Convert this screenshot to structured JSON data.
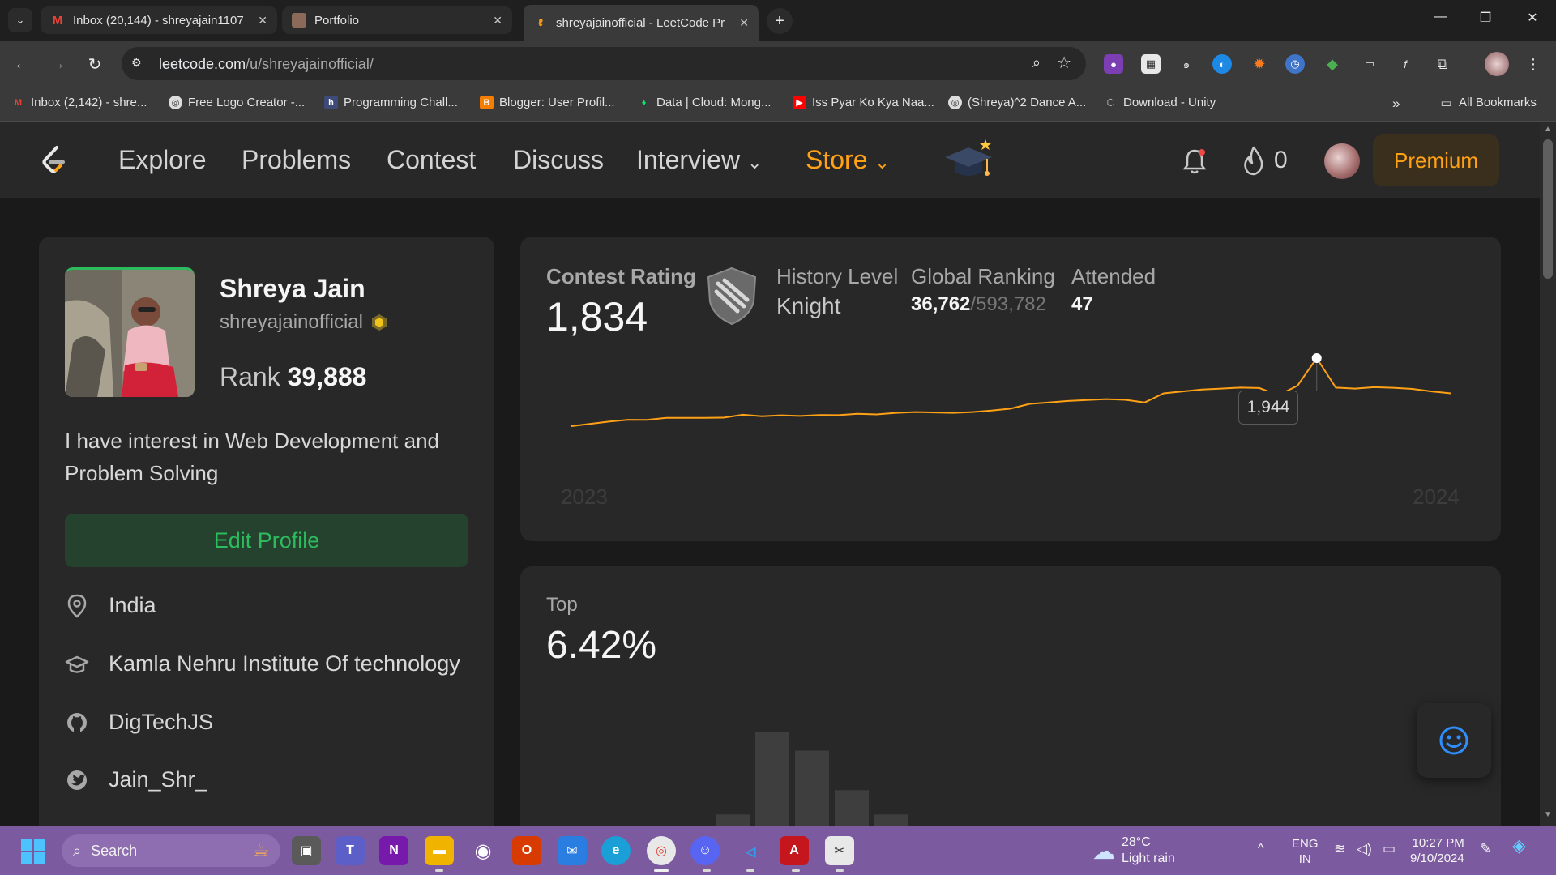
{
  "browser": {
    "tabs": [
      {
        "title": "Inbox (20,144) - shreyajain1107",
        "favicon": "gmail-icon"
      },
      {
        "title": "Portfolio",
        "favicon": "portfolio-avatar-icon"
      },
      {
        "title": "shreyajainofficial - LeetCode Pr",
        "favicon": "leetcode-icon",
        "active": true
      }
    ],
    "url_host": "leetcode.com",
    "url_path": "/u/shreyajainofficial/",
    "bookmarks": [
      {
        "label": "Inbox (2,142) - shre..."
      },
      {
        "label": "Free Logo Creator -..."
      },
      {
        "label": "Programming Chall..."
      },
      {
        "label": "Blogger: User Profil..."
      },
      {
        "label": "Data | Cloud: Mong..."
      },
      {
        "label": "Iss Pyar Ko Kya Naa..."
      },
      {
        "label": "(Shreya)^2 Dance A..."
      },
      {
        "label": "Download - Unity"
      }
    ],
    "all_bookmarks": "All Bookmarks"
  },
  "nav": {
    "explore": "Explore",
    "problems": "Problems",
    "contest": "Contest",
    "discuss": "Discuss",
    "interview": "Interview",
    "store": "Store",
    "streak": "0",
    "premium": "Premium"
  },
  "profile": {
    "name": "Shreya Jain",
    "username": "shreyajainofficial",
    "rank_label": "Rank",
    "rank_value": "39,888",
    "bio": "I have interest in Web Development and Problem Solving",
    "edit_button": "Edit Profile",
    "location": "India",
    "school": "Kamla Nehru Institute Of technology",
    "github": "DigTechJS",
    "twitter": "Jain_Shr_"
  },
  "contest": {
    "rating_label": "Contest Rating",
    "rating_value": "1,834",
    "history_level_label": "History Level",
    "history_level_value": "Knight",
    "global_ranking_label": "Global Ranking",
    "global_ranking_value": "36,762",
    "global_ranking_total": "/593,782",
    "attended_label": "Attended",
    "attended_value": "47",
    "tooltip": "1,944",
    "year_start": "2023",
    "year_end": "2024"
  },
  "top": {
    "label": "Top",
    "value": "6.42%"
  },
  "chart_data": [
    {
      "type": "line",
      "series": [
        {
          "values": [
            1588,
            1600,
            1612,
            1622,
            1621,
            1632,
            1632,
            1632,
            1633,
            1648,
            1640,
            1645,
            1642,
            1647,
            1646,
            1653,
            1650,
            1658,
            1662,
            1660,
            1658,
            1662,
            1670,
            1680,
            1705,
            1712,
            1720,
            1725,
            1730,
            1726,
            1712,
            1760,
            1770,
            1780,
            1785,
            1790,
            1788,
            1750,
            1800,
            1944,
            1790,
            1785,
            1792,
            1789,
            1783,
            1770,
            1760
          ]
        }
      ],
      "highlight": {
        "value": 1944
      }
    },
    {
      "type": "bar",
      "values": [
        2,
        18,
        72,
        60,
        34,
        18,
        8,
        4
      ]
    }
  ],
  "taskbar": {
    "search": "Search",
    "weather_temp": "28°C",
    "weather_desc": "Light rain",
    "lang": "ENG",
    "region": "IN",
    "time": "10:27 PM",
    "date": "9/10/2024"
  },
  "colors": {
    "accent": "#ffa116",
    "green": "#2cbb5d",
    "taskbar": "#7c5aa0"
  }
}
